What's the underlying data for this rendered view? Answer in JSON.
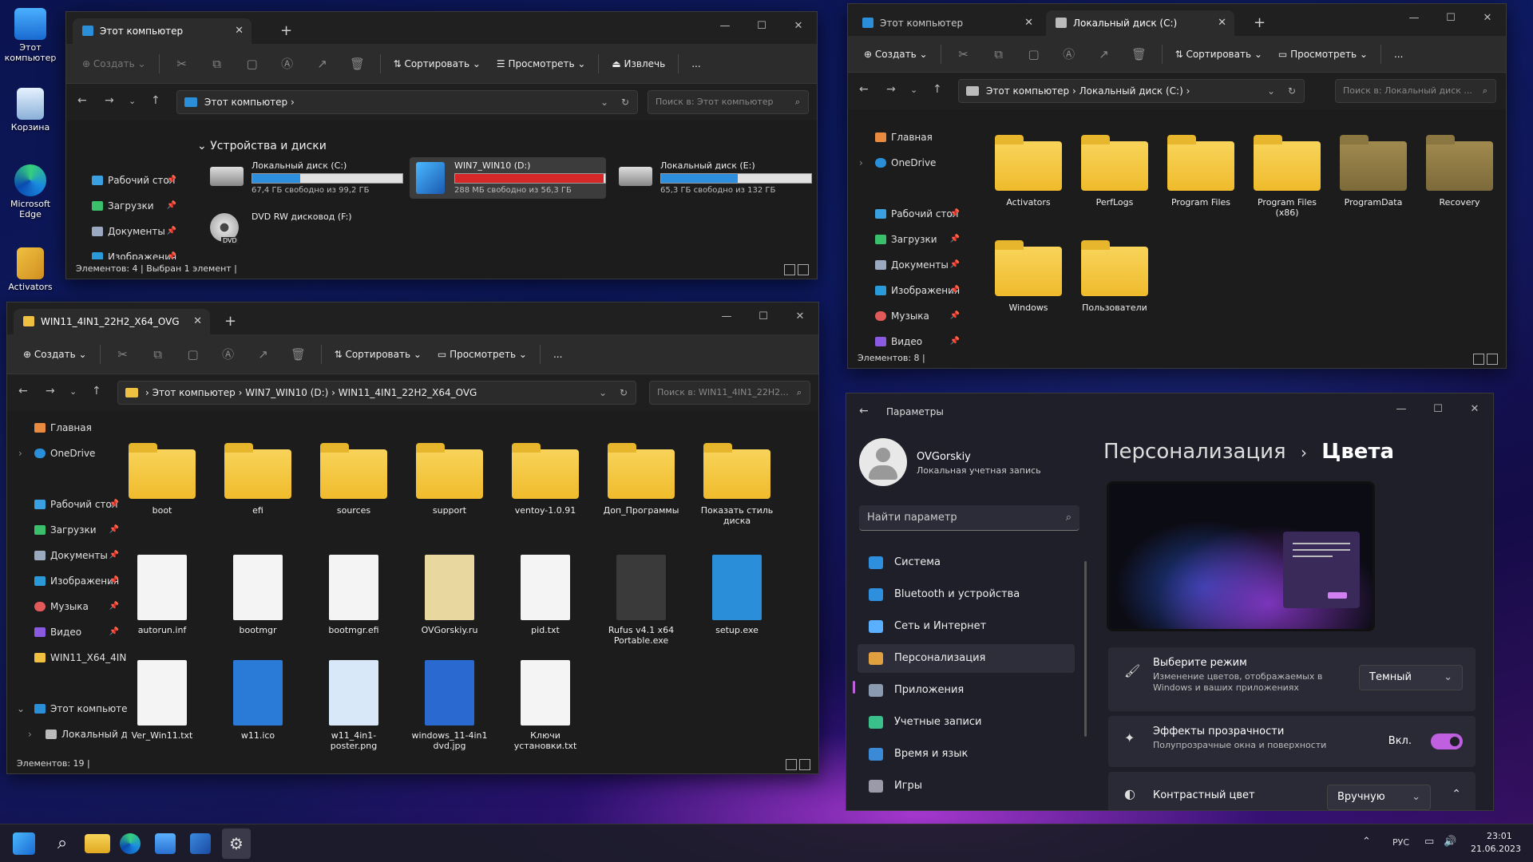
{
  "desktop": {
    "icons": [
      {
        "label": "Этот компьютер"
      },
      {
        "label": "Корзина"
      },
      {
        "label": "Microsoft Edge"
      },
      {
        "label": "Activators"
      }
    ]
  },
  "win1": {
    "tab": "Этот компьютер",
    "toolbar": {
      "create": "Создать",
      "sort": "Сортировать",
      "view": "Просмотреть",
      "eject": "Извлечь",
      "more": "..."
    },
    "address": "Этот компьютер",
    "search": "Поиск в: Этот компьютер",
    "sidebar": [
      {
        "label": "Рабочий стол"
      },
      {
        "label": "Загрузки"
      },
      {
        "label": "Документы"
      },
      {
        "label": "Изображения"
      }
    ],
    "section": "Устройства и диски",
    "drives": [
      {
        "name": "Локальный диск (C:)",
        "free": "67,4 ГБ свободно из 99,2 ГБ",
        "used": 0.32,
        "color": "#2d8fde"
      },
      {
        "name": "WIN7_WIN10 (D:)",
        "free": "288 МБ свободно из 56,3 ГБ",
        "used": 0.99,
        "color": "#d62828"
      },
      {
        "name": "Локальный диск (E:)",
        "free": "65,3 ГБ свободно из 132 ГБ",
        "used": 0.51,
        "color": "#2d8fde"
      },
      {
        "name": "DVD RW дисковод (F:)",
        "free": "",
        "used": 0,
        "color": "#2d8fde"
      }
    ],
    "dvd_label": "DVD",
    "status": "Элементов: 4  |  Выбран 1 элемент  |"
  },
  "win2": {
    "tabs": [
      "Этот компьютер",
      "Локальный диск (C:)"
    ],
    "toolbar": {
      "create": "Создать",
      "sort": "Сортировать",
      "view": "Просмотреть",
      "more": "..."
    },
    "address": "Этот компьютер  ›  Локальный диск (C:)  ›",
    "search": "Поиск в: Локальный диск ...",
    "sidebar": [
      {
        "label": "Главная"
      },
      {
        "label": "OneDrive"
      },
      {
        "label": "Рабочий стол"
      },
      {
        "label": "Загрузки"
      },
      {
        "label": "Документы"
      },
      {
        "label": "Изображения"
      },
      {
        "label": "Музыка"
      },
      {
        "label": "Видео"
      }
    ],
    "folders": [
      {
        "name": "Activators"
      },
      {
        "name": "PerfLogs"
      },
      {
        "name": "Program Files"
      },
      {
        "name": "Program Files (x86)"
      },
      {
        "name": "ProgramData"
      },
      {
        "name": "Recovery"
      },
      {
        "name": "Windows"
      },
      {
        "name": "Пользователи"
      }
    ],
    "status": "Элементов: 8  |"
  },
  "win3": {
    "tab": "WIN11_4IN1_22H2_X64_OVG",
    "toolbar": {
      "create": "Создать",
      "sort": "Сортировать",
      "view": "Просмотреть",
      "more": "..."
    },
    "address": "›  Этот компьютер  ›  WIN7_WIN10 (D:)  ›  WIN11_4IN1_22H2_X64_OVG",
    "search": "Поиск в: WIN11_4IN1_22H2...",
    "sidebar": [
      {
        "label": "Главная"
      },
      {
        "label": "OneDrive"
      },
      {
        "label": "Рабочий стол"
      },
      {
        "label": "Загрузки"
      },
      {
        "label": "Документы"
      },
      {
        "label": "Изображения"
      },
      {
        "label": "Музыка"
      },
      {
        "label": "Видео"
      },
      {
        "label": "WIN11_X64_4IN"
      },
      {
        "label": "Этот компьютер"
      },
      {
        "label": "Локальный ди"
      }
    ],
    "items": [
      {
        "name": "boot"
      },
      {
        "name": "efi"
      },
      {
        "name": "sources"
      },
      {
        "name": "support"
      },
      {
        "name": "ventoy-1.0.91"
      },
      {
        "name": "Доп_Программы"
      },
      {
        "name": "Показать стиль диска"
      },
      {
        "name": "autorun.inf"
      },
      {
        "name": "bootmgr"
      },
      {
        "name": "bootmgr.efi"
      },
      {
        "name": "OVGorskiy.ru"
      },
      {
        "name": "pid.txt"
      },
      {
        "name": "Rufus v4.1 x64 Portable.exe"
      },
      {
        "name": "setup.exe"
      },
      {
        "name": "Ver_Win11.txt"
      },
      {
        "name": "w11.ico"
      },
      {
        "name": "w11_4in1-poster.png"
      },
      {
        "name": "windows_11-4in1 dvd.jpg"
      },
      {
        "name": "Ключи установки.txt"
      }
    ],
    "status": "Элементов: 19  |"
  },
  "settings": {
    "title": "Параметры",
    "user": {
      "name": "OVGorskiy",
      "sub": "Локальная учетная запись"
    },
    "search_placeholder": "Найти параметр",
    "nav": [
      {
        "label": "Система",
        "color": "#2d8fde"
      },
      {
        "label": "Bluetooth и устройства",
        "color": "#2d8fde"
      },
      {
        "label": "Сеть и Интернет",
        "color": "#5ab0ff"
      },
      {
        "label": "Персонализация",
        "color": "#e0a040"
      },
      {
        "label": "Приложения",
        "color": "#8a9ab0"
      },
      {
        "label": "Учетные записи",
        "color": "#3ac08a"
      },
      {
        "label": "Время и язык",
        "color": "#3a8ad8"
      },
      {
        "label": "Игры",
        "color": "#9a9aa8"
      }
    ],
    "breadcrumb": {
      "parent": "Персонализация",
      "sep": "›",
      "current": "Цвета"
    },
    "cards": [
      {
        "title": "Выберите режим",
        "sub": "Изменение цветов, отображаемых в Windows и ваших приложениях",
        "value": "Темный"
      },
      {
        "title": "Эффекты прозрачности",
        "sub": "Полупрозрачные окна и поверхности",
        "value": "Вкл."
      },
      {
        "title": "Контрастный цвет",
        "sub": "",
        "value": "Вручную"
      }
    ],
    "accent": "#c060e0"
  },
  "taskbar": {
    "lang": "РУС",
    "time": "23:01",
    "date": "21.06.2023"
  }
}
